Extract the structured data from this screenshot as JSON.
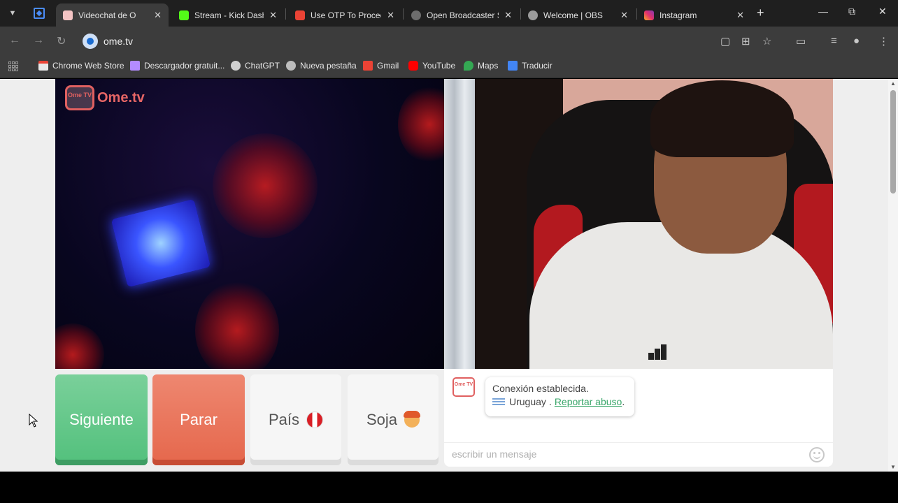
{
  "browser": {
    "tabs": [
      {
        "title": "Videochat de O",
        "active": true
      },
      {
        "title": "Stream - Kick Dashb",
        "active": false
      },
      {
        "title": "Use OTP To Proceed",
        "active": false
      },
      {
        "title": "Open Broadcaster S",
        "active": false
      },
      {
        "title": "Welcome | OBS",
        "active": false
      },
      {
        "title": "Instagram",
        "active": false
      }
    ],
    "new_tab_label": "+",
    "address": "ome.tv",
    "bookmarks": [
      {
        "label": "Chrome Web Store",
        "icon": "chrome-web-store-icon"
      },
      {
        "label": "Descargador gratuit...",
        "icon": "downloader-icon"
      },
      {
        "label": "ChatGPT",
        "icon": "chatgpt-icon"
      },
      {
        "label": "Nueva pestaña",
        "icon": "globe-icon"
      },
      {
        "label": "Gmail",
        "icon": "gmail-icon"
      },
      {
        "label": "YouTube",
        "icon": "youtube-icon"
      },
      {
        "label": "Maps",
        "icon": "maps-icon"
      },
      {
        "label": "Traducir",
        "icon": "translate-icon"
      }
    ]
  },
  "omegle": {
    "logo_badge": "Ome TV",
    "logo_text": "Ome.tv",
    "buttons": {
      "next": "Siguiente",
      "stop": "Parar",
      "country": "País",
      "gender": "Soja"
    },
    "chat": {
      "status": "Conexión establecida.",
      "country": "Uruguay",
      "separator": ".",
      "report_link": "Reportar abuso",
      "trailing": ".",
      "placeholder": "escribir un mensaje"
    }
  },
  "colors": {
    "next_button": "#52c07c",
    "stop_button": "#e5674c",
    "link": "#3aa66a",
    "brand": "#e06060"
  }
}
